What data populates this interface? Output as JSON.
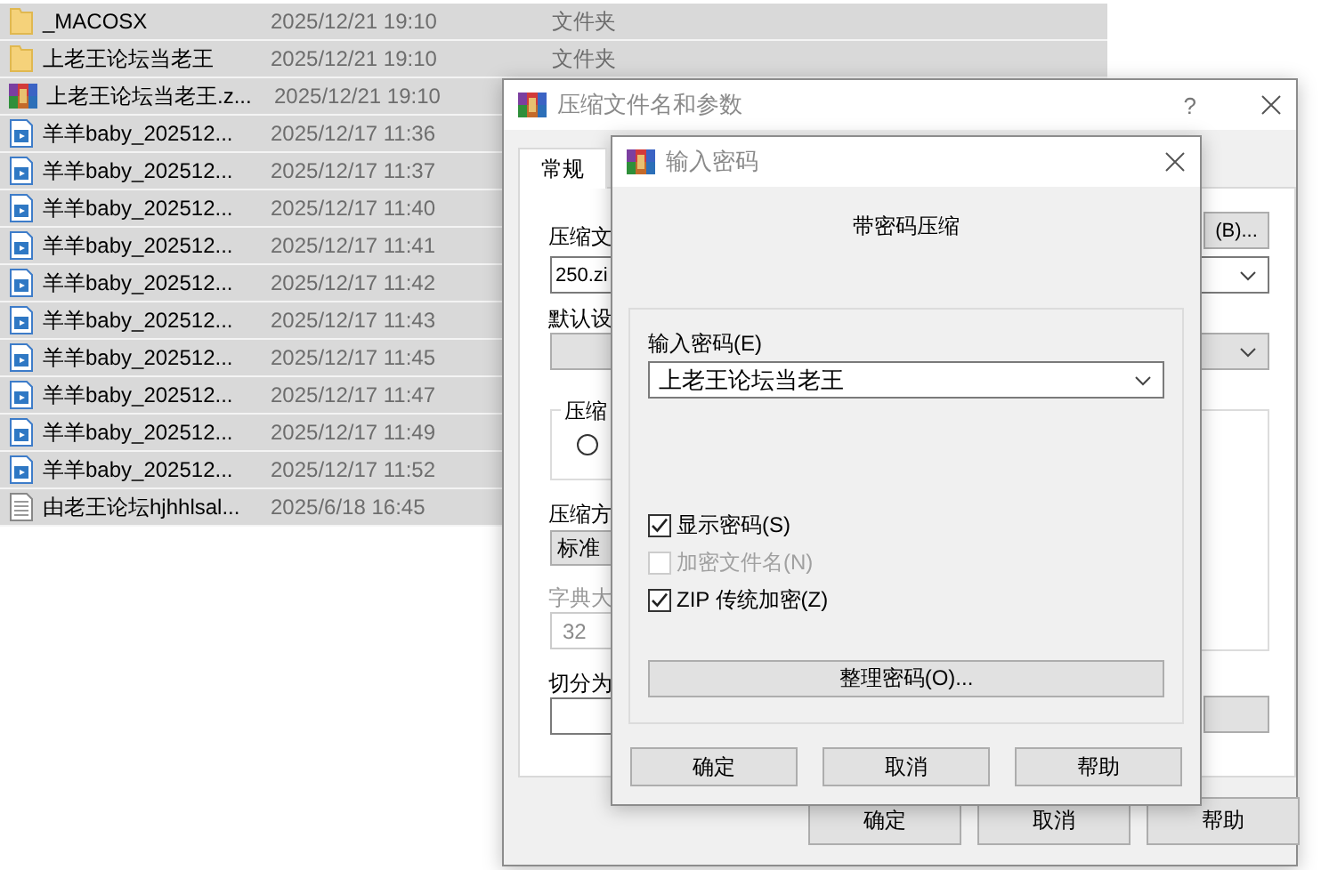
{
  "file_list": {
    "rows": [
      {
        "kind": "folder",
        "name": "_MACOSX",
        "date": "2025/12/21 19:10",
        "type": "文件夹",
        "selected": true
      },
      {
        "kind": "folder",
        "name": "上老王论坛当老王",
        "date": "2025/12/21 19:10",
        "type": "文件夹",
        "selected": true
      },
      {
        "kind": "archive",
        "name": "上老王论坛当老王.z...",
        "date": "2025/12/21 19:10",
        "selected": true
      },
      {
        "kind": "video",
        "name": "羊羊baby_202512...",
        "date": "2025/12/17 11:36",
        "selected": true
      },
      {
        "kind": "video",
        "name": "羊羊baby_202512...",
        "date": "2025/12/17 11:37",
        "selected": true
      },
      {
        "kind": "video",
        "name": "羊羊baby_202512...",
        "date": "2025/12/17 11:40",
        "selected": true
      },
      {
        "kind": "video",
        "name": "羊羊baby_202512...",
        "date": "2025/12/17 11:41",
        "selected": true
      },
      {
        "kind": "video",
        "name": "羊羊baby_202512...",
        "date": "2025/12/17 11:42",
        "selected": true
      },
      {
        "kind": "video",
        "name": "羊羊baby_202512...",
        "date": "2025/12/17 11:43",
        "selected": true
      },
      {
        "kind": "video",
        "name": "羊羊baby_202512...",
        "date": "2025/12/17 11:45",
        "selected": true
      },
      {
        "kind": "video",
        "name": "羊羊baby_202512...",
        "date": "2025/12/17 11:47",
        "selected": true
      },
      {
        "kind": "video",
        "name": "羊羊baby_202512...",
        "date": "2025/12/17 11:49",
        "selected": true
      },
      {
        "kind": "video",
        "name": "羊羊baby_202512...",
        "date": "2025/12/17 11:52",
        "selected": true
      },
      {
        "kind": "text",
        "name": "由老王论坛hjhhlsal...",
        "date": "2025/6/18 16:45",
        "selected": true
      }
    ]
  },
  "main_dialog": {
    "title": "压缩文件名和参数",
    "help": "?",
    "tabs": [
      {
        "label": "常规",
        "selected": true
      }
    ],
    "archive_name_label": "压缩文",
    "browse_button": "(B)...",
    "archive_name": "250.zi",
    "profile_label": "默认设",
    "format_group_label": "压缩",
    "format_radio": {
      "selected": false
    },
    "method_label": "压缩方",
    "method_value": "标准",
    "dictionary_label": "字典大",
    "dictionary_value": "32",
    "dictionary_disabled": true,
    "split_label": "切分为",
    "buttons": [
      "确定",
      "取消",
      "帮助"
    ]
  },
  "password_dialog": {
    "title": "输入密码",
    "heading": "带密码压缩",
    "password_label": "输入密码(E)",
    "password_value": "上老王论坛当老王",
    "options": [
      {
        "label": "显示密码(S)",
        "checked": true,
        "disabled": false
      },
      {
        "label": "加密文件名(N)",
        "checked": false,
        "disabled": true
      },
      {
        "label": "ZIP 传统加密(Z)",
        "checked": true,
        "disabled": false
      }
    ],
    "manage_button": "整理密码(O)...",
    "buttons": [
      "确定",
      "取消",
      "帮助"
    ]
  }
}
